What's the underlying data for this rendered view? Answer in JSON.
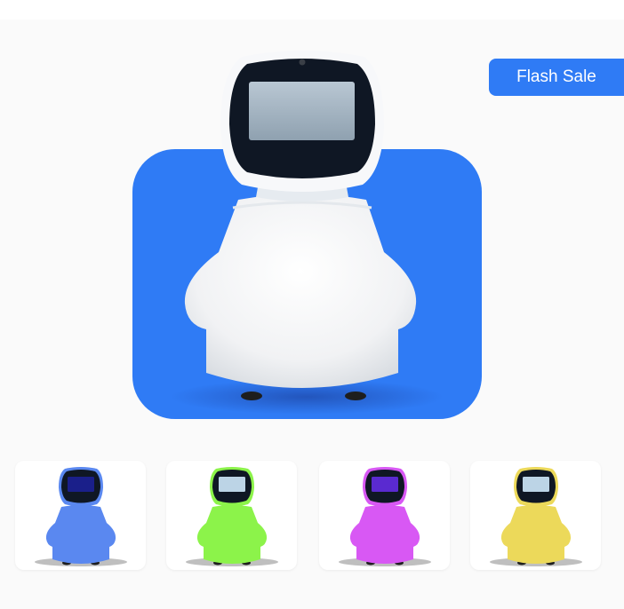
{
  "badge": {
    "label": "Flash Sale"
  },
  "product": {
    "main_image": {
      "icon": "robot-white-icon",
      "body_color": "#ffffff"
    },
    "variants": [
      {
        "icon": "robot-blue-icon",
        "body_color": "#5a88f0",
        "screen_color": "#1a1f8a"
      },
      {
        "icon": "robot-green-icon",
        "body_color": "#8cf34a",
        "screen_color": "#bcd4e6"
      },
      {
        "icon": "robot-purple-icon",
        "body_color": "#d858f4",
        "screen_color": "#5a2ad0"
      },
      {
        "icon": "robot-yellow-icon",
        "body_color": "#ecd95a",
        "screen_color": "#bcd4e6"
      }
    ]
  },
  "colors": {
    "accent": "#2f7bf5",
    "background": "#fafafa"
  }
}
